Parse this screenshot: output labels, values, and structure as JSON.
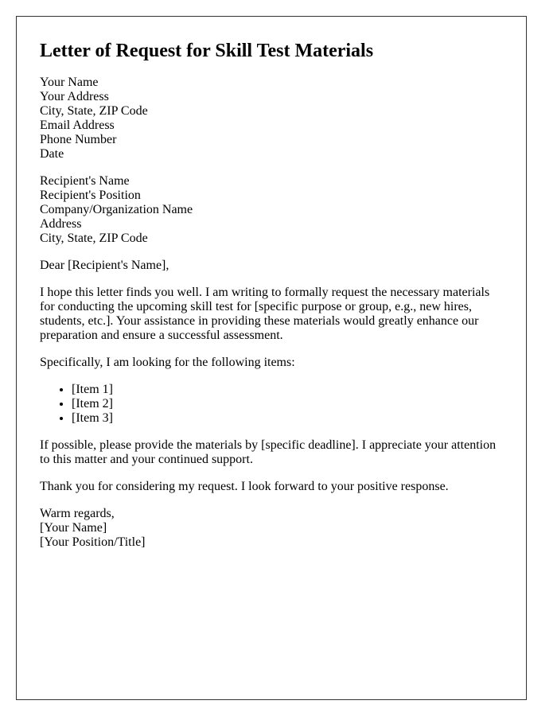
{
  "title": "Letter of Request for Skill Test Materials",
  "sender": [
    "Your Name",
    "Your Address",
    "City, State, ZIP Code",
    "Email Address",
    "Phone Number",
    "Date"
  ],
  "recipient": [
    "Recipient's Name",
    "Recipient's Position",
    "Company/Organization Name",
    "Address",
    "City, State, ZIP Code"
  ],
  "salutation": "Dear [Recipient's Name],",
  "paragraphs": {
    "intro": "I hope this letter finds you well. I am writing to formally request the necessary materials for conducting the upcoming skill test for [specific purpose or group, e.g., new hires, students, etc.]. Your assistance in providing these materials would greatly enhance our preparation and ensure a successful assessment.",
    "items_lead": "Specifically, I am looking for the following items:",
    "deadline": "If possible, please provide the materials by [specific deadline]. I appreciate your attention to this matter and your continued support.",
    "thanks": "Thank you for considering my request. I look forward to your positive response."
  },
  "items": [
    "[Item 1]",
    "[Item 2]",
    "[Item 3]"
  ],
  "closing": [
    "Warm regards,",
    "[Your Name]",
    "[Your Position/Title]"
  ]
}
